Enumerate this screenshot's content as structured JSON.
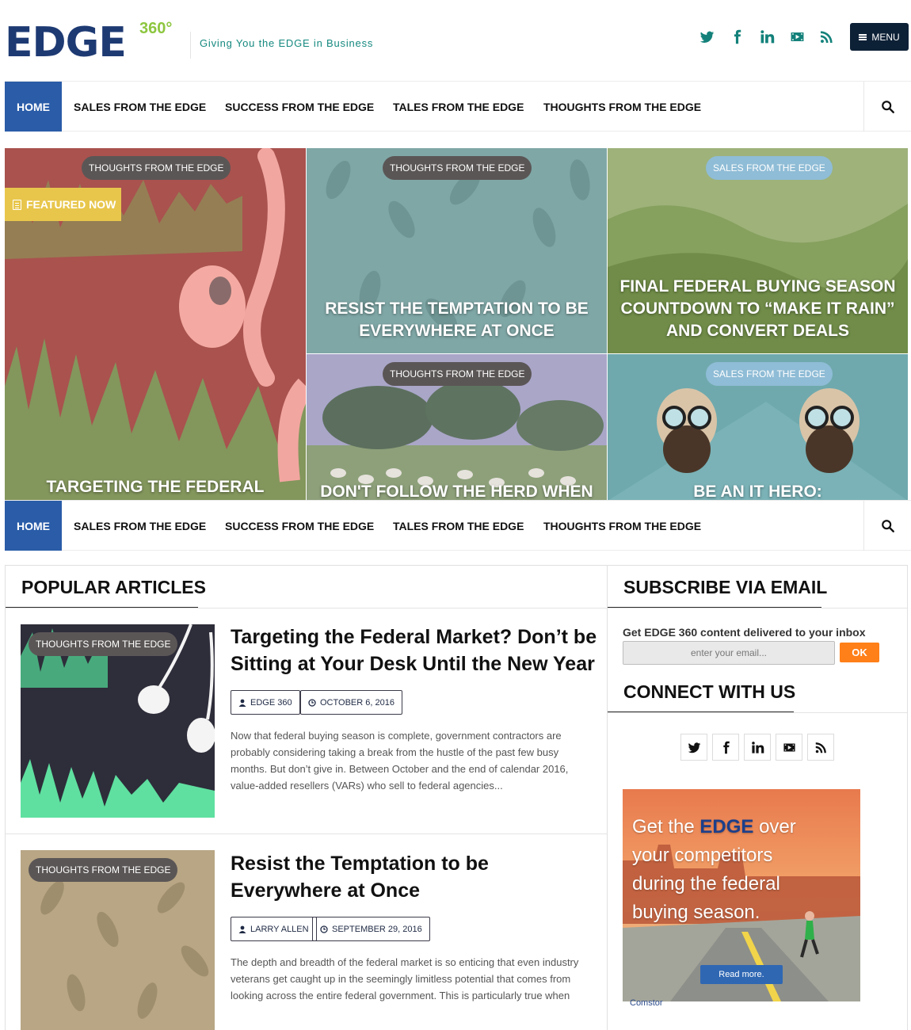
{
  "header": {
    "logo_text": "EDGE",
    "logo_sup": "360°",
    "tagline": "Giving You the EDGE in Business",
    "menu_label": "MENU",
    "social_icons": [
      "twitter-icon",
      "facebook-icon",
      "linkedin-icon",
      "youtube-icon",
      "rss-icon"
    ]
  },
  "nav": {
    "items": [
      "HOME",
      "SALES FROM THE EDGE",
      "SUCCESS FROM THE EDGE",
      "TALES FROM THE EDGE",
      "THOUGHTS FROM THE EDGE"
    ]
  },
  "hero": {
    "featured_label": "FEATURED NOW",
    "tiles": [
      {
        "category": "THOUGHTS FROM THE EDGE",
        "title": "TARGETING THE FEDERAL"
      },
      {
        "category": "THOUGHTS FROM THE EDGE",
        "title": "RESIST THE TEMPTATION TO BE EVERYWHERE AT ONCE"
      },
      {
        "category": "SALES FROM THE EDGE",
        "title": "FINAL FEDERAL BUYING SEASON COUNTDOWN TO “MAKE IT RAIN” AND CONVERT DEALS"
      },
      {
        "category": "THOUGHTS FROM THE EDGE",
        "title": "DON'T FOLLOW THE HERD WHEN"
      },
      {
        "category": "SALES FROM THE EDGE",
        "title": "BE AN IT HERO: HYPERCONVERGED"
      }
    ]
  },
  "popular": {
    "heading": "POPULAR ARTICLES",
    "articles": [
      {
        "category": "THOUGHTS FROM THE EDGE",
        "title": "Targeting the Federal Market? Don’t be Sitting at Your Desk Until the New Year",
        "author": "EDGE 360",
        "date": "OCTOBER 6, 2016",
        "excerpt": "Now that federal buying season is complete, government contractors are probably considering taking a break from the hustle of the past few busy months.  But don’t give in. Between October and the end of calendar 2016, value-added resellers (VARs) who sell to federal agencies..."
      },
      {
        "category": "THOUGHTS FROM THE EDGE",
        "title": "Resist the Temptation to be Everywhere at Once",
        "author": "LARRY ALLEN",
        "date": "SEPTEMBER 29, 2016",
        "excerpt": "The depth and breadth of the federal market is so enticing that even industry veterans get caught up in the seemingly limitless potential that comes from looking across the entire federal government. This is particularly true when speaking with a new company or sales..."
      }
    ]
  },
  "sidebar": {
    "subscribe_heading": "SUBSCRIBE VIA EMAIL",
    "subscribe_label": "Get EDGE 360 content delivered to your inbox",
    "email_placeholder": "enter your email...",
    "ok_label": "OK",
    "connect_heading": "CONNECT WITH US",
    "connect_icons": [
      "twitter-icon",
      "facebook-icon",
      "linkedin-icon",
      "youtube-icon",
      "rss-icon"
    ],
    "ad": {
      "line1_pre": "Get the ",
      "line1_em": "EDGE",
      "line1_post": " over your competitors during the federal buying season.",
      "button": "Read more.",
      "brand": "Comstor"
    }
  },
  "colors": {
    "brand_navy": "#1e3a73",
    "accent_green": "#8dc63f",
    "social_teal": "#13817a",
    "nav_home": "#2a5ca8",
    "featured_yellow": "#e8c64c",
    "ok_orange": "#ff7f18"
  }
}
